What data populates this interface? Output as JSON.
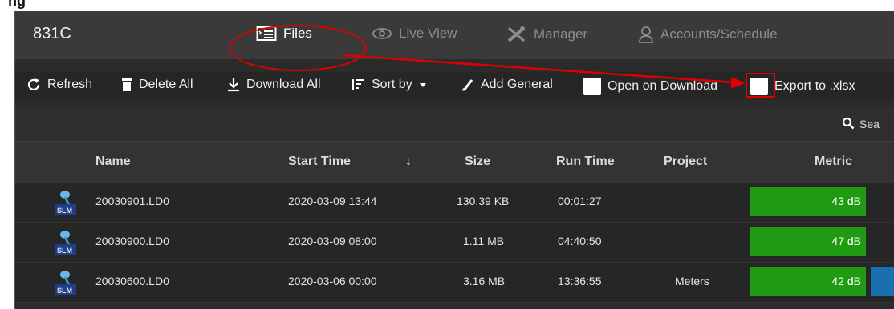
{
  "device": {
    "name": "831C"
  },
  "nav": {
    "files": "Files",
    "live_view": "Live View",
    "manager": "Manager",
    "accounts": "Accounts/Schedule"
  },
  "toolbar": {
    "refresh": "Refresh",
    "delete_all": "Delete All",
    "download_all": "Download All",
    "sort_by": "Sort by",
    "add_general": "Add General",
    "open_on_download": "Open on Download",
    "export_xlsx": "Export to .xlsx"
  },
  "search": {
    "placeholder": "Sea"
  },
  "table": {
    "columns": [
      "Name",
      "Start Time",
      "Size",
      "Run Time",
      "Project",
      "Metric"
    ],
    "rows": [
      {
        "icon_label": "SLM",
        "name": "20030901.LD0",
        "start": "2020-03-09 13:44",
        "size": "130.39 KB",
        "run": "00:01:27",
        "project": "",
        "metric": "43 dB"
      },
      {
        "icon_label": "SLM",
        "name": "20030900.LD0",
        "start": "2020-03-09 08:00",
        "size": "1.11 MB",
        "run": "04:40:50",
        "project": "",
        "metric": "47 dB"
      },
      {
        "icon_label": "SLM",
        "name": "20030600.LD0",
        "start": "2020-03-06 00:00",
        "size": "3.16 MB",
        "run": "13:36:55",
        "project": "Meters",
        "metric": "42 dB"
      }
    ]
  },
  "colors": {
    "annotation": "#e00000",
    "metric_green": "#1f9a12",
    "header_bg": "#3a3a3a"
  }
}
